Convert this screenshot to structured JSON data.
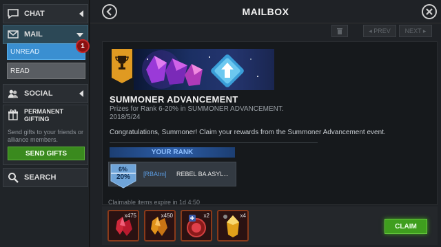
{
  "sidebar": {
    "chat_label": "CHAT",
    "mail_label": "MAIL",
    "unread_label": "UNREAD",
    "unread_count": "1",
    "read_label": "READ",
    "social_label": "SOCIAL",
    "gifting_title": "PERMANENT GIFTING",
    "gifting_desc": "Send gifts to your friends or alliance members.",
    "send_gifts_label": "SEND GIFTS",
    "search_label": "SEARCH"
  },
  "header": {
    "title": "MAILBOX"
  },
  "toolbar": {
    "prev_label": "◂ PREV",
    "next_label": "NEXT ▸"
  },
  "message": {
    "title": "SUMMONER ADVANCEMENT",
    "subtitle": "Prizes for Rank 6-20% in SUMMONER ADVANCEMENT.",
    "date": "2018/5/24",
    "body": "Congratulations, Summoner! Claim your rewards from the Summoner Advancement event.",
    "your_rank_label": "YOUR RANK",
    "rank_low": "6%",
    "rank_high": "20%",
    "alliance_tag": "[RBAtm]",
    "player_name": "REBEL BA ASYL..."
  },
  "footer": {
    "expire_text": "Claimable items expire in 1d 4:50",
    "claim_label": "CLAIM",
    "items": [
      {
        "name": "red-shard-icon",
        "qty": "x475"
      },
      {
        "name": "gold-shard-icon",
        "qty": "x450"
      },
      {
        "name": "potion-icon",
        "qty": "x2"
      },
      {
        "name": "crystal-icon",
        "qty": "x4"
      }
    ]
  },
  "colors": {
    "accent_blue": "#3a8fd1",
    "claim_green": "#3f9e1e",
    "badge_red": "#8a1010"
  }
}
